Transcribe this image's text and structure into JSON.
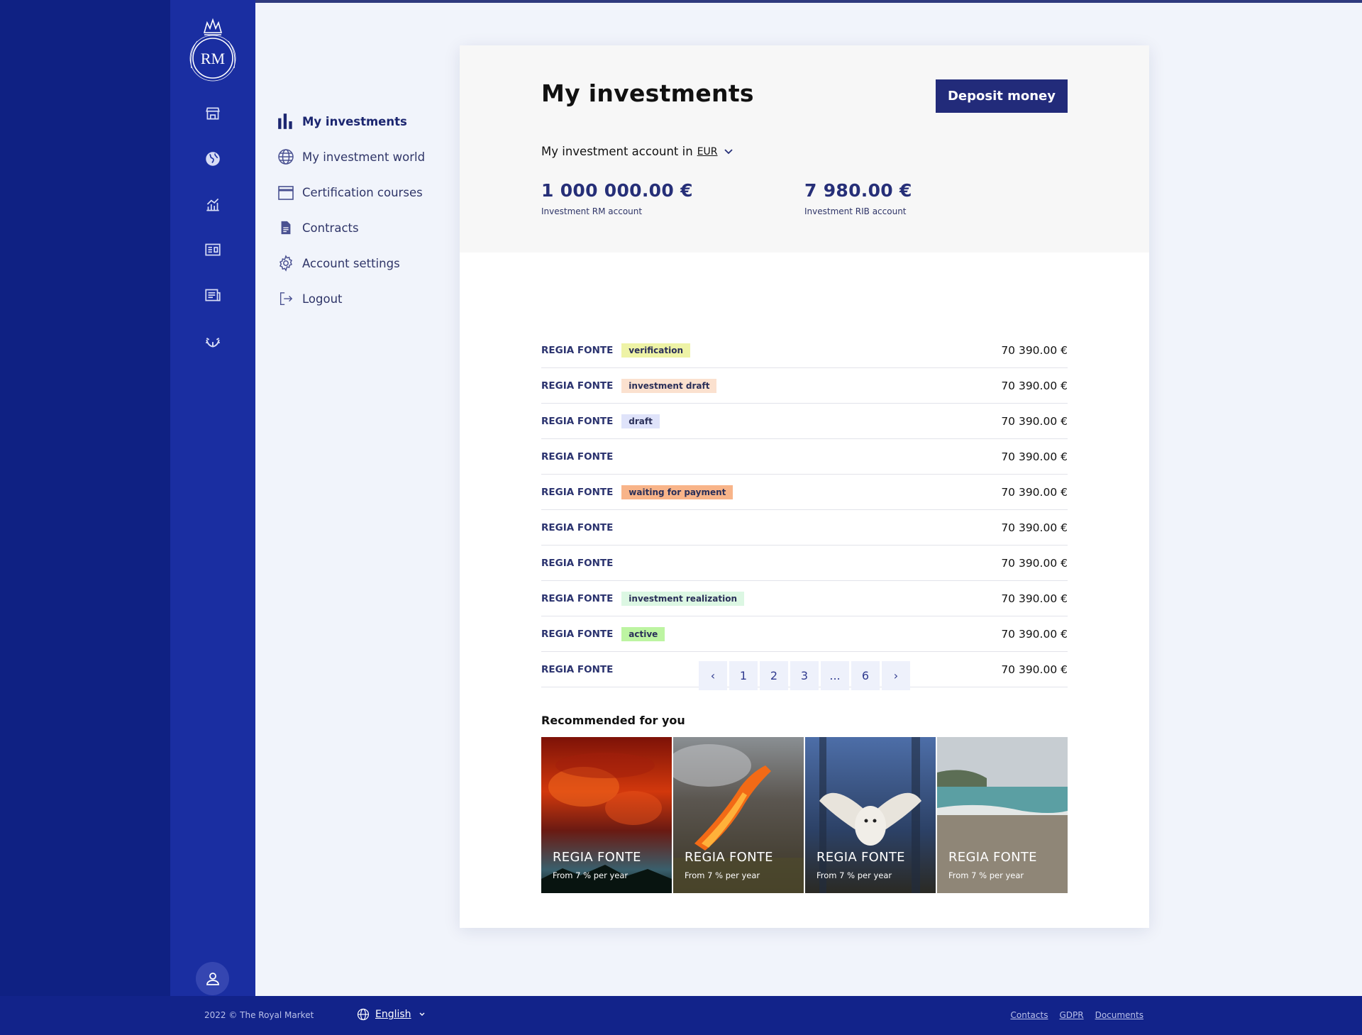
{
  "sidebar": {
    "logo_text": "RM",
    "rail_icons": [
      "store-icon",
      "globe-icon",
      "chart-icon",
      "id-card-icon",
      "newspaper-icon",
      "laurel-icon"
    ]
  },
  "nav": {
    "items": [
      {
        "label": "My investments",
        "icon": "bar-chart-icon",
        "active": true
      },
      {
        "label": "My investment world",
        "icon": "globe-icon"
      },
      {
        "label": "Certification courses",
        "icon": "calendar-icon"
      },
      {
        "label": "Contracts",
        "icon": "document-icon"
      },
      {
        "label": "Account settings",
        "icon": "gear-icon"
      },
      {
        "label": "Logout",
        "icon": "logout-icon"
      }
    ]
  },
  "main": {
    "title": "My investments",
    "deposit_label": "Deposit money",
    "account_label": "My investment account in",
    "currency": "EUR",
    "balances": [
      {
        "amount": "1 000 000.00 €",
        "label": "Investment RM account"
      },
      {
        "amount": "7 980.00 €",
        "label": "Investment RIB account"
      }
    ],
    "investments": [
      {
        "name": "REGIA FONTE",
        "status": "verification",
        "value": "70 390.00 €"
      },
      {
        "name": "REGIA FONTE",
        "status": "investment draft",
        "value": "70 390.00 €"
      },
      {
        "name": "REGIA FONTE",
        "status": "draft",
        "value": "70 390.00 €"
      },
      {
        "name": "REGIA FONTE",
        "status": "",
        "value": "70 390.00 €"
      },
      {
        "name": "REGIA FONTE",
        "status": "waiting for payment",
        "value": "70 390.00 €"
      },
      {
        "name": "REGIA FONTE",
        "status": "",
        "value": "70 390.00 €"
      },
      {
        "name": "REGIA FONTE",
        "status": "",
        "value": "70 390.00 €"
      },
      {
        "name": "REGIA FONTE",
        "status": "investment realization",
        "value": "70 390.00 €"
      },
      {
        "name": "REGIA FONTE",
        "status": "active",
        "value": "70 390.00 €"
      },
      {
        "name": "REGIA FONTE",
        "status": "",
        "value": "70 390.00 €"
      }
    ],
    "status_colors": {
      "verification": "#eef3a6",
      "investment draft": "#fbe1cf",
      "draft": "#dfe3fa",
      "waiting for payment": "#f8b489",
      "investment realization": "#dcf7e3",
      "active": "#bdf4a2"
    },
    "pagination": [
      "‹",
      "1",
      "2",
      "3",
      "...",
      "6",
      "›"
    ],
    "recommended_title": "Recommended for you",
    "recommended": [
      {
        "name": "REGIA FONTE",
        "sub": "From 7 % per year",
        "scene": "volcanic-smoke"
      },
      {
        "name": "REGIA FONTE",
        "sub": "From 7 % per year",
        "scene": "lava-flow"
      },
      {
        "name": "REGIA FONTE",
        "sub": "From 7 % per year",
        "scene": "snowy-owl"
      },
      {
        "name": "REGIA FONTE",
        "sub": "From 7 % per year",
        "scene": "beach"
      }
    ]
  },
  "footer": {
    "copyright": "2022 © The Royal Market",
    "language": "English",
    "links": [
      "Contacts",
      "GDPR",
      "Documents"
    ]
  },
  "colors": {
    "accent": "#222b7a",
    "rail": "#1a2ea1",
    "far_left": "#0f2183"
  }
}
